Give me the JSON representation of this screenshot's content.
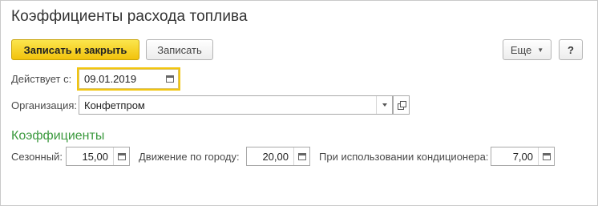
{
  "window": {
    "title": "Коэффициенты расхода топлива"
  },
  "toolbar": {
    "save_close_label": "Записать и закрыть",
    "save_label": "Записать",
    "more_label": "Еще",
    "help_label": "?"
  },
  "form": {
    "date_label": "Действует с:",
    "date_value": "09.01.2019",
    "org_label": "Организация:",
    "org_value": "Конфетпром"
  },
  "coefficients": {
    "section_title": "Коэффициенты",
    "seasonal_label": "Сезонный:",
    "seasonal_value": "15,00",
    "city_label": "Движение по городу:",
    "city_value": "20,00",
    "ac_label": "При использовании кондиционера:",
    "ac_value": "7,00"
  },
  "colors": {
    "accent_yellow": "#f2c20c",
    "section_green": "#3c9a3f"
  },
  "icons": [
    "calendar-icon",
    "dropdown-arrow-icon",
    "open-form-icon",
    "calculator-icon"
  ]
}
